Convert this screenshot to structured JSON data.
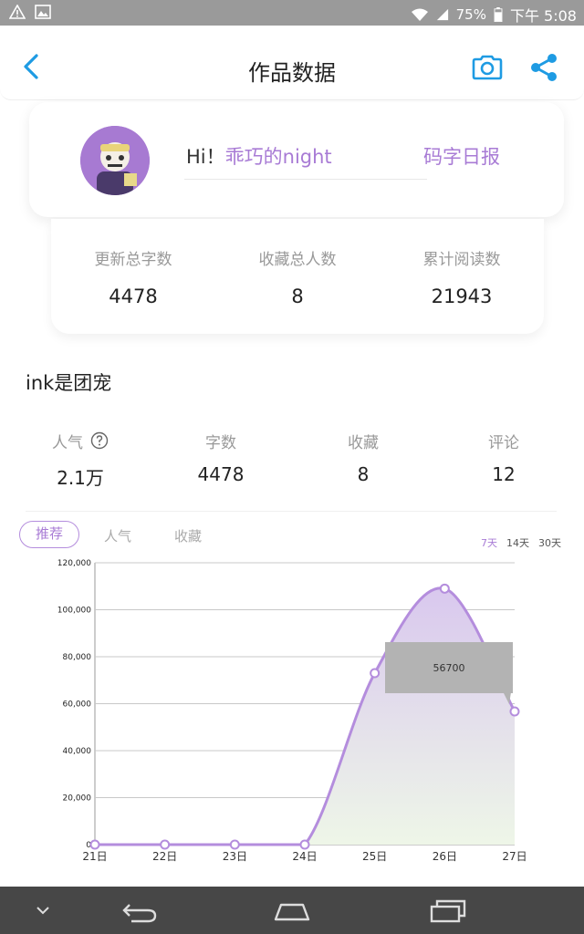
{
  "status": {
    "battery": "75%",
    "time": "下午 5:08",
    "icons": [
      "warning-notification-icon",
      "image-notification-icon",
      "wifi-icon",
      "signal-icon",
      "battery-icon"
    ]
  },
  "header": {
    "title": "作品数据",
    "icons": [
      "back-icon",
      "camera-icon",
      "share-icon"
    ]
  },
  "profile": {
    "greeting": "Hi！",
    "username": "乖巧的night",
    "daily_report": "码字日报"
  },
  "totals": [
    {
      "label": "更新总字数",
      "value": "4478"
    },
    {
      "label": "收藏总人数",
      "value": "8"
    },
    {
      "label": "累计阅读数",
      "value": "21943"
    }
  ],
  "work": {
    "title": "ink是团宠",
    "stats": [
      {
        "label": "人气",
        "value": "2.1万"
      },
      {
        "label": "字数",
        "value": "4478"
      },
      {
        "label": "收藏",
        "value": "8"
      },
      {
        "label": "评论",
        "value": "12"
      }
    ]
  },
  "tabs": [
    "推荐",
    "人气",
    "收藏"
  ],
  "ranges": [
    "7天",
    "14天",
    "30天"
  ],
  "colors": {
    "accent": "#a87bd5",
    "link_blue": "#1e9be3",
    "fill_top": "#d9c8ee",
    "fill_bottom": "#eef6e8",
    "tooltip": "#b3b3b3"
  },
  "chart_data": {
    "type": "area",
    "x": [
      "21日",
      "22日",
      "23日",
      "24日",
      "25日",
      "26日",
      "27日"
    ],
    "series": [
      {
        "values": [
          0,
          0,
          0,
          0,
          73000,
          109000,
          56700
        ]
      }
    ],
    "ylim": [
      0,
      120000
    ],
    "yticks": [
      "0",
      "20,000",
      "40,000",
      "60,000",
      "80,000",
      "100,000",
      "120,000"
    ],
    "grid": true,
    "tooltip": "56700"
  }
}
